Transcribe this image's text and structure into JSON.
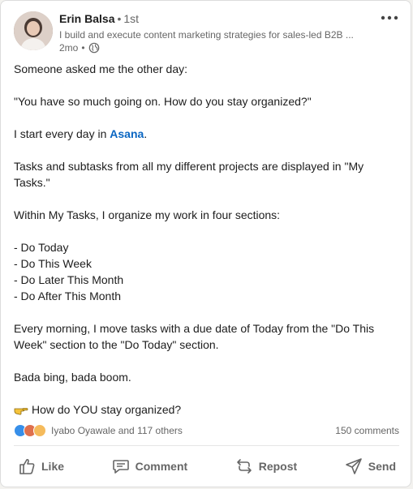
{
  "post": {
    "author": {
      "name": "Erin Balsa",
      "degree": "1st",
      "headline": "I build and execute content marketing strategies for sales-led B2B ...",
      "time": "2mo",
      "visibility_icon": "globe-icon"
    },
    "body": {
      "line1": "Someone asked me the other day:",
      "line2": "\"You have so much going on. How do you stay organized?\"",
      "line3_prefix": "I start every day in ",
      "line3_mention": "Asana",
      "line3_suffix": ".",
      "line4": "Tasks and subtasks from all my different projects are displayed in \"My Tasks.\"",
      "line5": "Within My Tasks, I organize my work in four sections:",
      "sections": [
        "- Do Today",
        "- Do This Week",
        "- Do Later This Month",
        "- Do After This Month"
      ],
      "line6": "Every morning, I move tasks with a due date of Today from the \"Do This Week\" section to the \"Do Today\" section.",
      "line7": "Bada bing, bada boom.",
      "line8": "How do YOU stay organized?"
    },
    "social": {
      "reaction_icons": [
        "like-reaction-icon",
        "love-reaction-icon",
        "insightful-reaction-icon"
      ],
      "names": "Iyabo Oyawale and 117 others",
      "comments": "150 comments"
    },
    "actions": {
      "like": "Like",
      "comment": "Comment",
      "repost": "Repost",
      "send": "Send"
    }
  },
  "colors": {
    "link": "#0a66c2",
    "muted": "#666666",
    "text": "#1d1d1d"
  }
}
